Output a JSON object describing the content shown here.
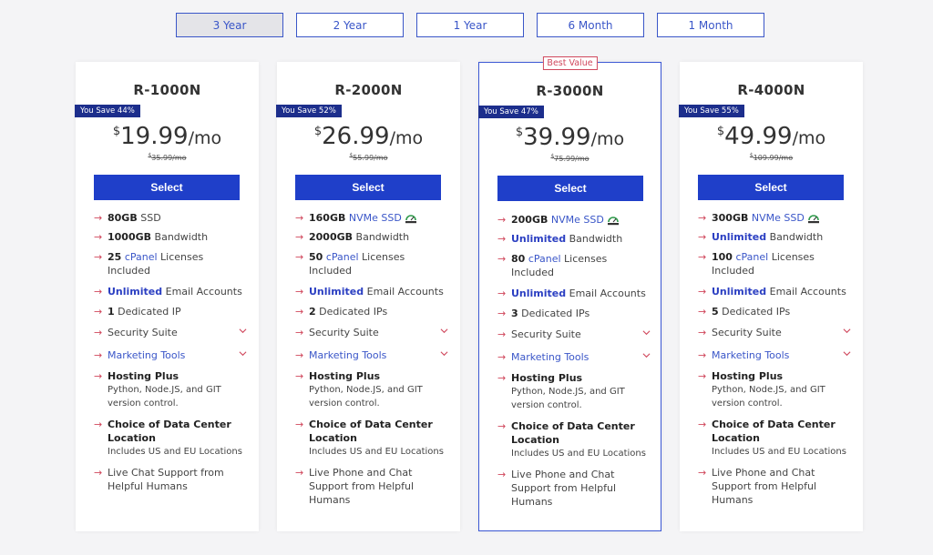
{
  "terms": [
    "3 Year",
    "2 Year",
    "1 Year",
    "6 Month",
    "1 Month"
  ],
  "active_term": "3 Year",
  "best_value_label": "Best Value",
  "select_label": "Select",
  "currency": "$",
  "per": "/mo",
  "accent": "#1f3fc9",
  "arrow_color": "#d0475c",
  "plans": [
    {
      "name": "R-1000N",
      "save": "You Save 44%",
      "price": "19.99",
      "old_price": "35.99",
      "old_per": "/mo",
      "storage_amt": "80GB",
      "storage_type": "SSD",
      "bandwidth": "1000GB",
      "bandwidth_label": "Bandwidth",
      "cpanel_count": "25",
      "cpanel_label": "cPanel",
      "cpanel_rest": "Licenses Included",
      "email_amt": "Unlimited",
      "email_label": "Email Accounts",
      "ip_count": "1",
      "ip_label": "Dedicated IP",
      "security": "Security Suite",
      "marketing": "Marketing Tools",
      "hosting_plus": "Hosting Plus",
      "hosting_plus_sub": "Python, Node.JS, and GIT version control.",
      "dc": "Choice of Data Center Location",
      "dc_sub": "Includes US and EU Locations",
      "support": "Live Chat Support from Helpful Humans"
    },
    {
      "name": "R-2000N",
      "save": "You Save 52%",
      "price": "26.99",
      "old_price": "55.99",
      "old_per": "/mo",
      "storage_amt": "160GB",
      "storage_type": "NVMe SSD",
      "bandwidth": "2000GB",
      "bandwidth_label": "Bandwidth",
      "cpanel_count": "50",
      "cpanel_label": "cPanel",
      "cpanel_rest": "Licenses Included",
      "email_amt": "Unlimited",
      "email_label": "Email Accounts",
      "ip_count": "2",
      "ip_label": "Dedicated IPs",
      "security": "Security Suite",
      "marketing": "Marketing Tools",
      "hosting_plus": "Hosting Plus",
      "hosting_plus_sub": "Python, Node.JS, and GIT version control.",
      "dc": "Choice of Data Center Location",
      "dc_sub": "Includes US and EU Locations",
      "support": "Live Phone and Chat Support from Helpful Humans"
    },
    {
      "name": "R-3000N",
      "save": "You Save 47%",
      "price": "39.99",
      "old_price": "75.99",
      "old_per": "/mo",
      "storage_amt": "200GB",
      "storage_type": "NVMe SSD",
      "bandwidth": "Unlimited",
      "bandwidth_label": "Bandwidth",
      "cpanel_count": "80",
      "cpanel_label": "cPanel",
      "cpanel_rest": "Licenses Included",
      "email_amt": "Unlimited",
      "email_label": "Email Accounts",
      "ip_count": "3",
      "ip_label": "Dedicated IPs",
      "security": "Security Suite",
      "marketing": "Marketing Tools",
      "hosting_plus": "Hosting Plus",
      "hosting_plus_sub": "Python, Node.JS, and GIT version control.",
      "dc": "Choice of Data Center Location",
      "dc_sub": "Includes US and EU Locations",
      "support": "Live Phone and Chat Support from Helpful Humans"
    },
    {
      "name": "R-4000N",
      "save": "You Save 55%",
      "price": "49.99",
      "old_price": "109.99",
      "old_per": "/mo",
      "storage_amt": "300GB",
      "storage_type": "NVMe SSD",
      "bandwidth": "Unlimited",
      "bandwidth_label": "Bandwidth",
      "cpanel_count": "100",
      "cpanel_label": "cPanel",
      "cpanel_rest": "Licenses Included",
      "email_amt": "Unlimited",
      "email_label": "Email Accounts",
      "ip_count": "5",
      "ip_label": "Dedicated IPs",
      "security": "Security Suite",
      "marketing": "Marketing Tools",
      "hosting_plus": "Hosting Plus",
      "hosting_plus_sub": "Python, Node.JS, and GIT version control.",
      "dc": "Choice of Data Center Location",
      "dc_sub": "Includes US and EU Locations",
      "support": "Live Phone and Chat Support from Helpful Humans"
    }
  ]
}
